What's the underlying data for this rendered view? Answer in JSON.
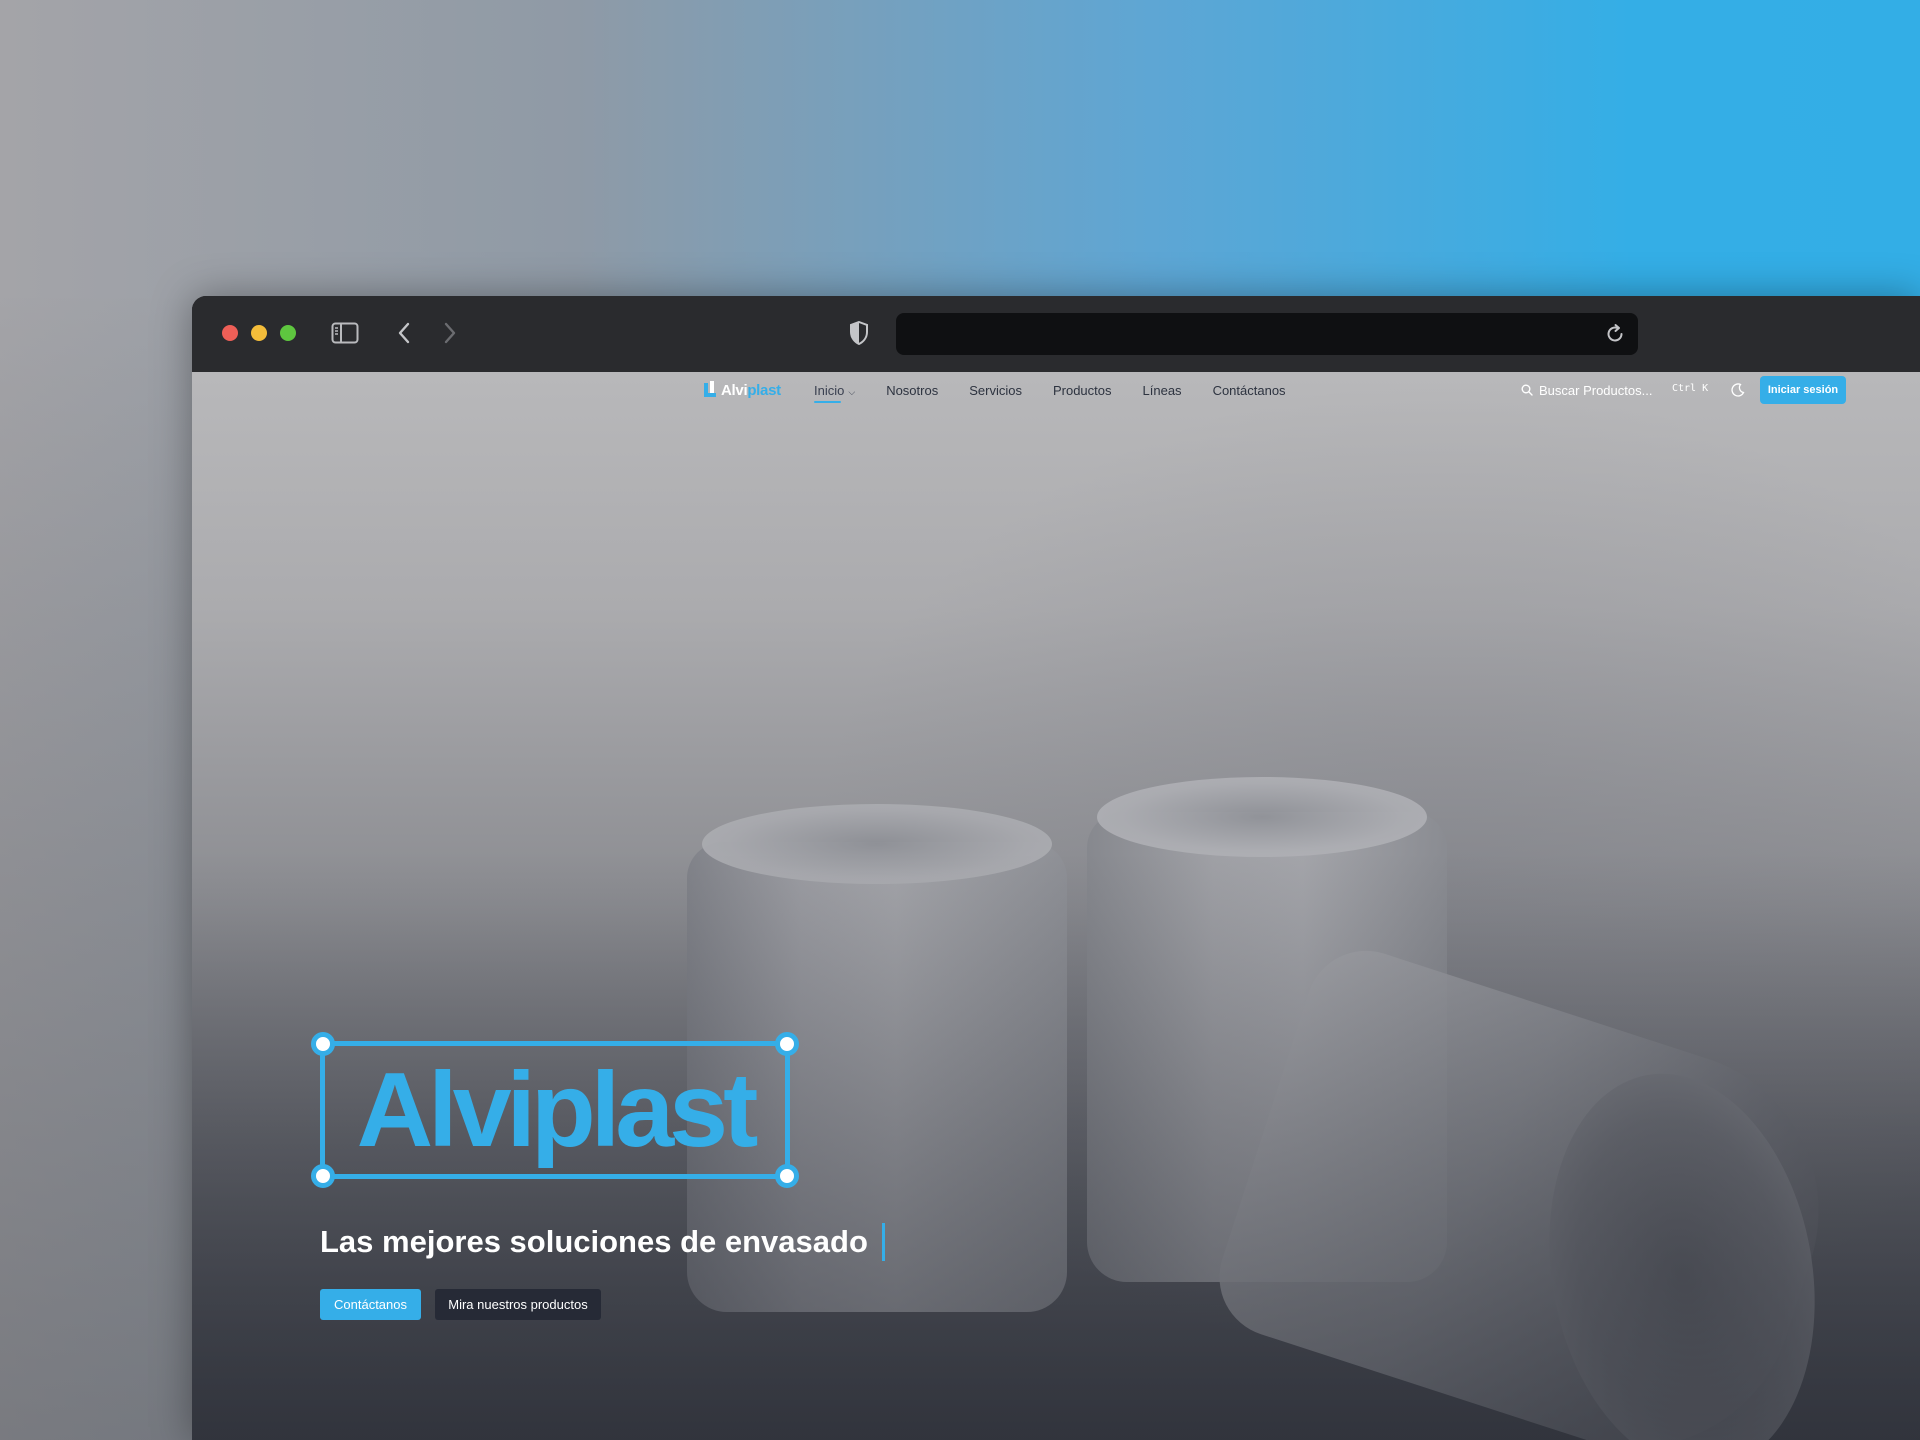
{
  "browser": {
    "url_value": "",
    "window_controls": [
      "close",
      "minimize",
      "zoom"
    ],
    "icons": {
      "sidebar": "sidebar-toggle-icon",
      "back": "chevron-left-icon",
      "forward": "chevron-right-icon",
      "privacy": "shield-icon",
      "reload": "reload-icon"
    }
  },
  "site": {
    "logo": {
      "part1": "Alvi",
      "part2": "plast"
    },
    "nav": [
      {
        "label": "Inicio",
        "active": true,
        "has_dropdown": true
      },
      {
        "label": "Nosotros"
      },
      {
        "label": "Servicios"
      },
      {
        "label": "Productos"
      },
      {
        "label": "Líneas"
      },
      {
        "label": "Contáctanos"
      }
    ],
    "search": {
      "label": "Buscar Productos...",
      "shortcut": "Ctrl K"
    },
    "login_label": "Iniciar sesión"
  },
  "hero": {
    "brand": "Alviplast",
    "tagline": "Las mejores soluciones de envasado",
    "primary_button": "Contáctanos",
    "secondary_button": "Mira nuestros productos"
  },
  "colors": {
    "accent": "#35aee8",
    "dark_button": "#262a36",
    "toolbar": "#2a2b2e"
  }
}
